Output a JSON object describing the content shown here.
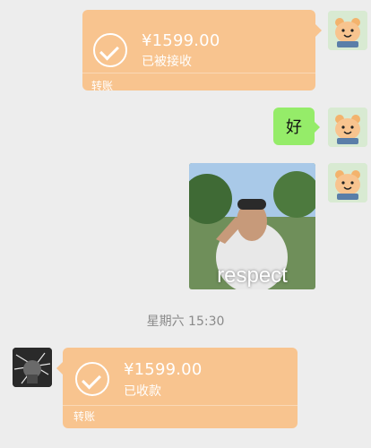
{
  "messages": [
    {
      "type": "transfer",
      "side": "right",
      "amount": "¥1599.00",
      "status": "已被接收",
      "footer": "转账"
    },
    {
      "type": "text",
      "side": "right",
      "text": "好"
    },
    {
      "type": "image",
      "side": "right",
      "caption": "respect"
    },
    {
      "type": "timestamp",
      "text": "星期六 15:30"
    },
    {
      "type": "transfer",
      "side": "left",
      "amount": "¥1599.00",
      "status": "已收款",
      "footer": "转账"
    }
  ],
  "colors": {
    "background": "#ededed",
    "transfer_bubble": "#f8c48f",
    "text_bubble": "#95ec69",
    "timestamp": "#8a8a8a"
  },
  "icons": [
    "check-circle-icon",
    "bear-avatar-icon"
  ]
}
